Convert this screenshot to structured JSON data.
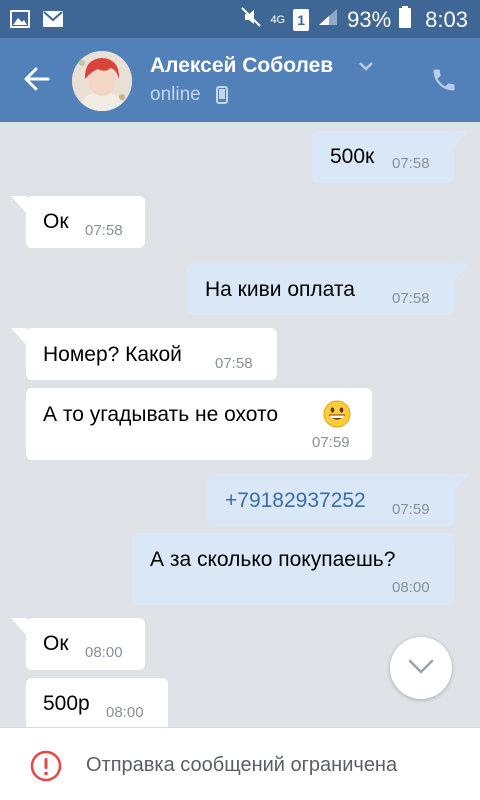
{
  "status_bar": {
    "network": "4G",
    "sim": "1",
    "battery": "93%",
    "time": "8:03"
  },
  "header": {
    "contact_name": "Алексей Соболев",
    "presence": "online",
    "icons": [
      "back-arrow-icon",
      "chevron-down-icon",
      "mobile-phone-icon",
      "call-icon"
    ]
  },
  "messages": [
    {
      "dir": "out",
      "text": "500к",
      "time": "07:58"
    },
    {
      "dir": "in",
      "text": "Ок",
      "time": "07:58"
    },
    {
      "dir": "out",
      "text": "На киви оплата",
      "time": "07:58"
    },
    {
      "dir": "in",
      "text": "Номер? Какой",
      "time": "07:58"
    },
    {
      "dir": "in",
      "text": "А то угадывать не охото",
      "time": "07:59"
    },
    {
      "dir": "out",
      "text": "+79182937252",
      "time": "07:59"
    },
    {
      "dir": "out",
      "text": "А за сколько покупаешь?",
      "time": "08:00"
    },
    {
      "dir": "in",
      "text": "Ок",
      "time": "08:00"
    },
    {
      "dir": "in",
      "text": "500р",
      "time": "08:00"
    }
  ],
  "footer": {
    "notice": "Отправка сообщений ограничена"
  },
  "colors": {
    "header": "#5181b8",
    "status_bar": "#3f6796",
    "background": "#dfe3e8",
    "outgoing_bubble": "#d9e7f7",
    "incoming_bubble": "#ffffff",
    "warning": "#e64646",
    "link": "#3b6ea8"
  }
}
